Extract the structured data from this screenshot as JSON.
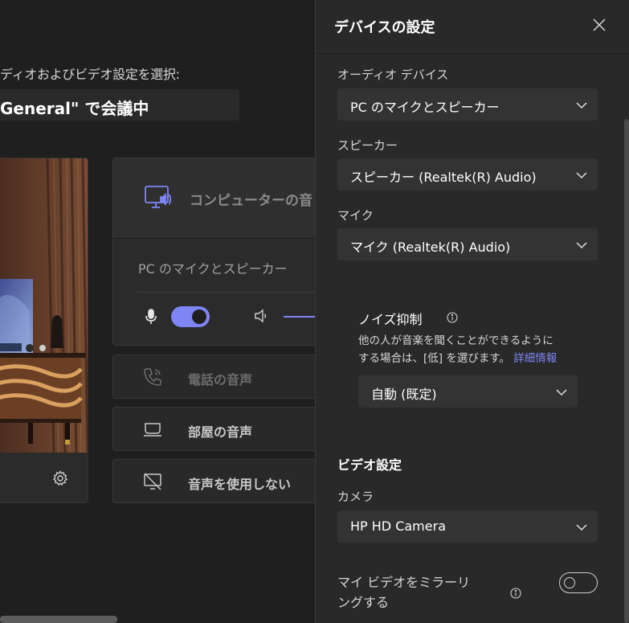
{
  "background": {
    "choose_label": "ディオおよびビデオ設定を選択:",
    "meeting_title": "General\" で会議中",
    "computer_audio_label": "コンピューターの音",
    "computer_device": "PC のマイクとスピーカー",
    "options": {
      "phone": "電話の音声",
      "room": "部屋の音声",
      "none": "音声を使用しない"
    },
    "mic_enabled": true,
    "accent_color": "#7f85f5"
  },
  "pane": {
    "title": "デバイスの設定",
    "audio_device": {
      "label": "オーディオ デバイス",
      "value": "PC のマイクとスピーカー"
    },
    "speaker": {
      "label": "スピーカー",
      "value": "スピーカー (Realtek(R) Audio)"
    },
    "mic": {
      "label": "マイク",
      "value": "マイク (Realtek(R) Audio)"
    },
    "noise": {
      "title": "ノイズ抑制",
      "desc_line1": "他の人が音楽を聞くことができるように",
      "desc_line2": "する場合は、[低] を選びます。",
      "link": "詳細情報",
      "value": "自動 (既定)"
    },
    "video_section": "ビデオ設定",
    "camera": {
      "label": "カメラ",
      "value": "HP HD Camera"
    },
    "mirror": {
      "line1": "マイ ビデオをミラーリ",
      "line2": "ングする",
      "enabled": false
    }
  },
  "icons": [
    "computer-speaker-icon",
    "mic-icon",
    "speaker-icon",
    "phone-icon",
    "room-icon",
    "no-audio-icon",
    "gear-icon",
    "close-icon",
    "chevron-down-icon",
    "info-icon"
  ]
}
